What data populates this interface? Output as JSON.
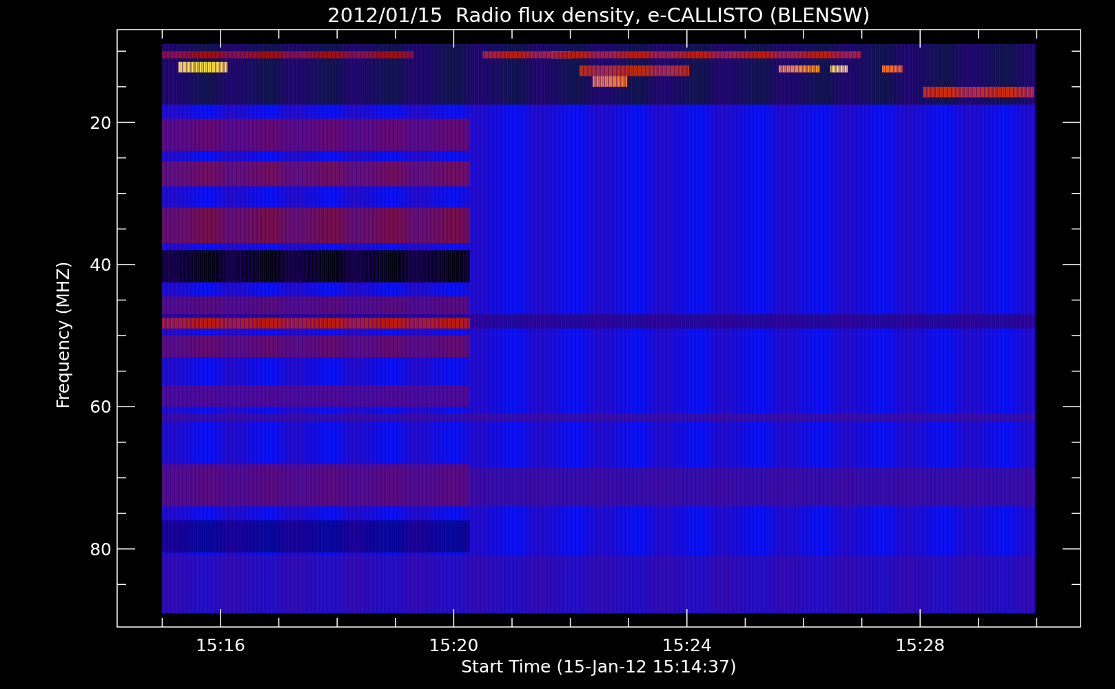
{
  "title": "2012/01/15  Radio flux density, e-CALLISTO (BLENSW)",
  "y_axis": {
    "label": "Frequency (MHZ)",
    "ticks": [
      "20",
      "40",
      "60",
      "80"
    ]
  },
  "x_axis": {
    "label": "Start Time (15-Jan-12 15:14:37)",
    "ticks": [
      "15:16",
      "15:20",
      "15:24",
      "15:28"
    ]
  }
}
